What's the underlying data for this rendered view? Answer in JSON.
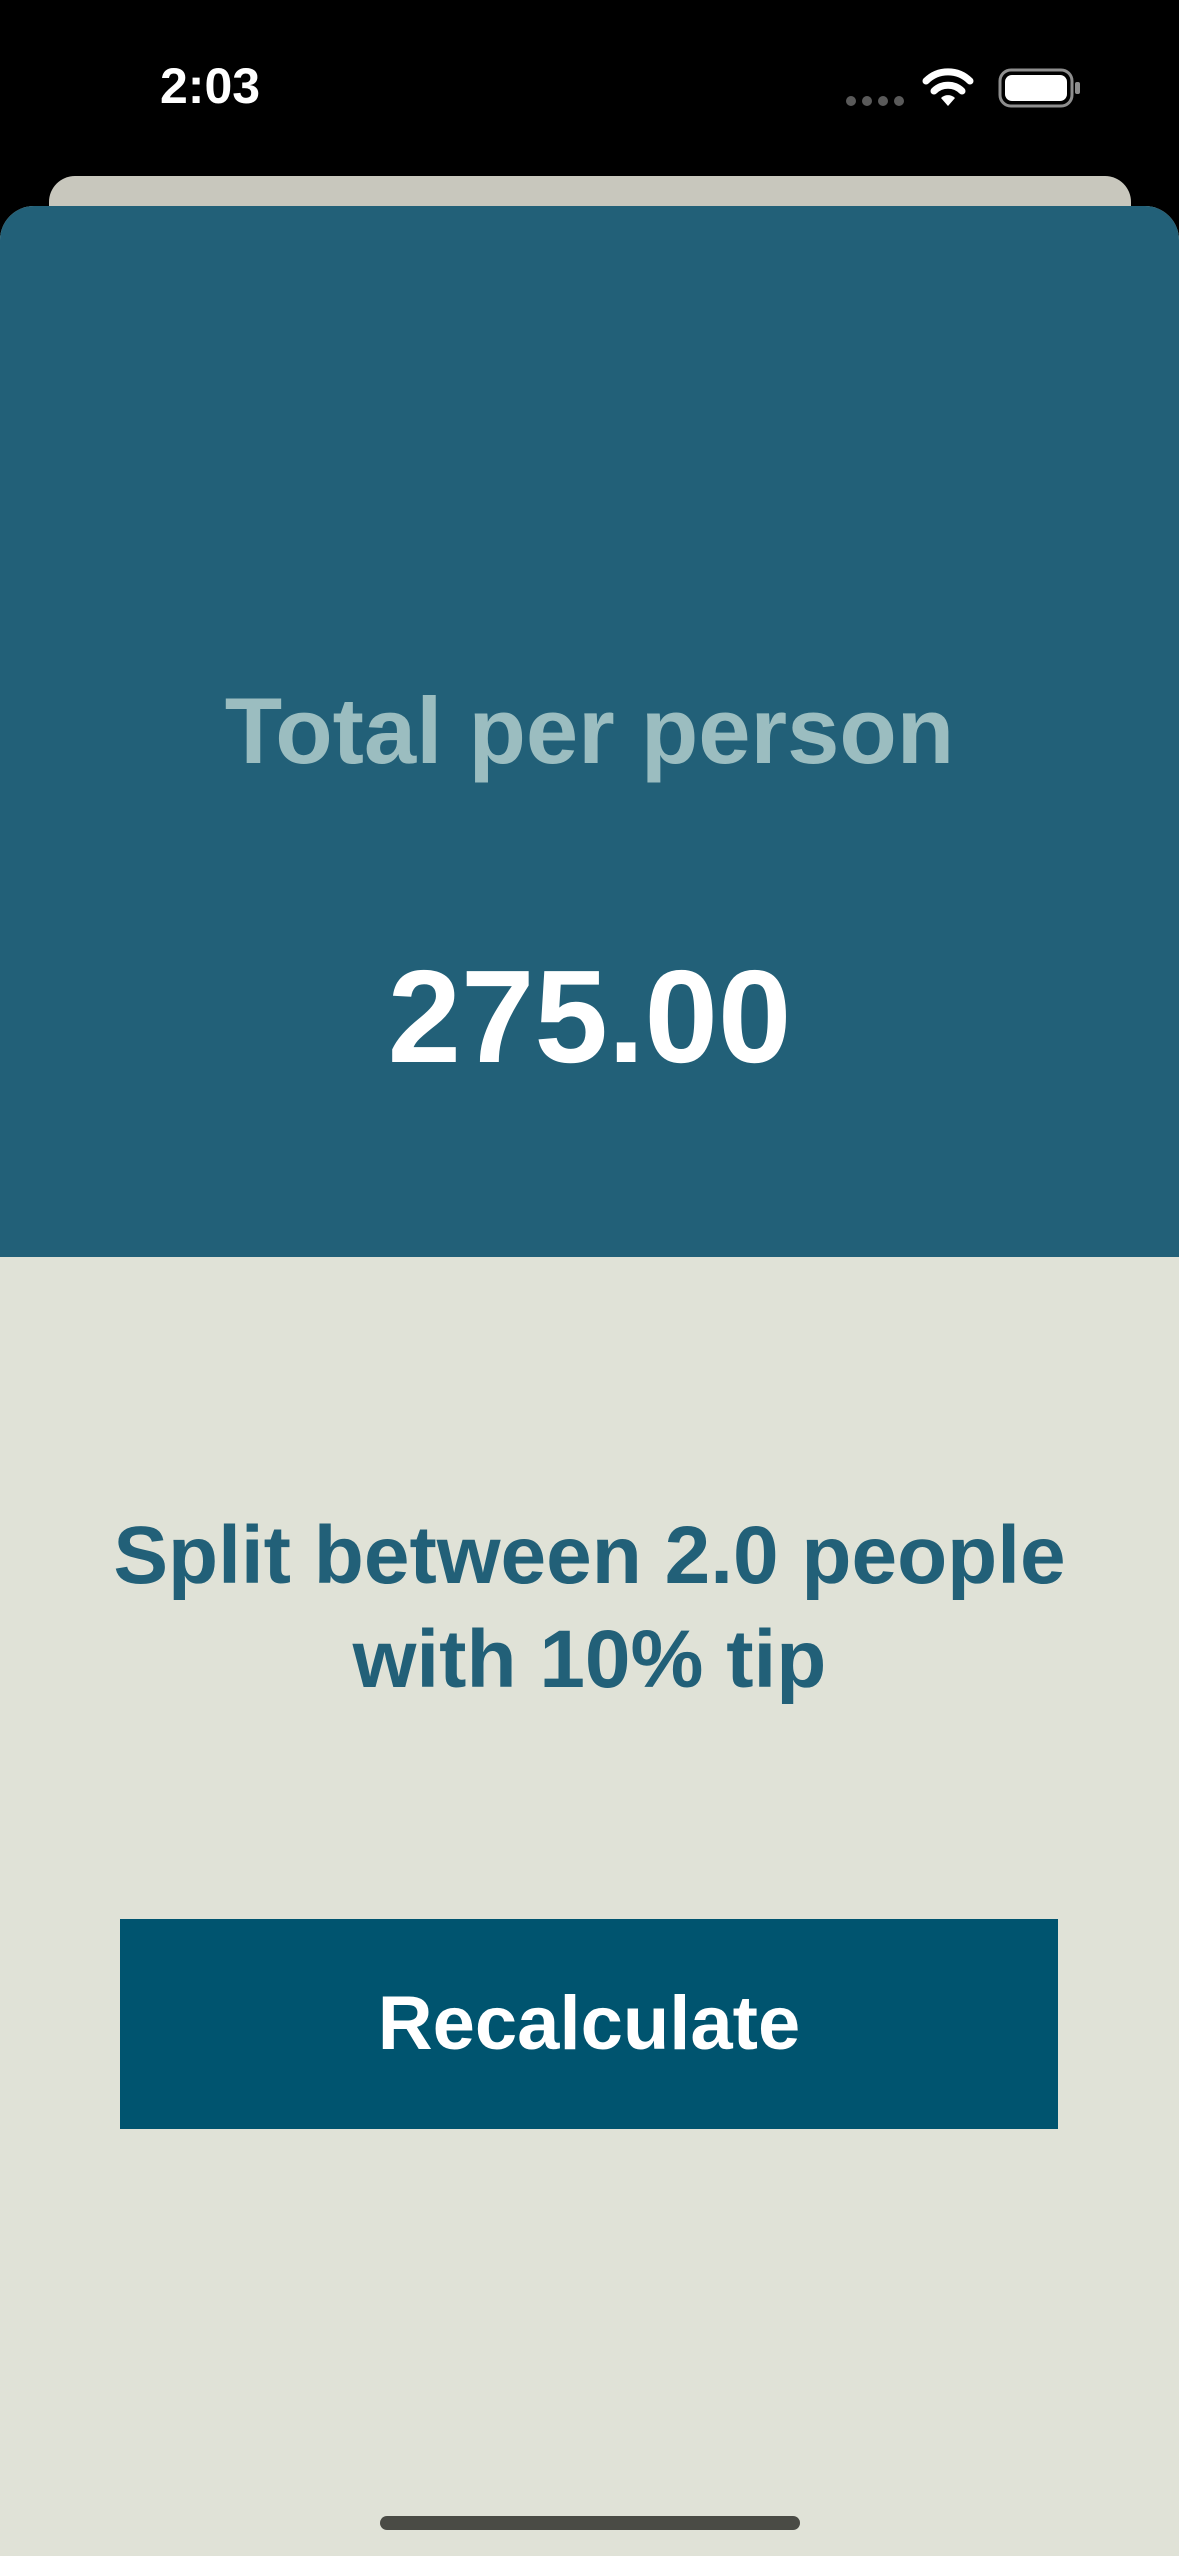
{
  "status_bar": {
    "time": "2:03",
    "icons": [
      "cellular-signal-icon",
      "wifi-icon",
      "battery-icon"
    ]
  },
  "result": {
    "title": "Total per person",
    "value": "275.00"
  },
  "summary": {
    "text": "Split between 2.0 people with 10% tip"
  },
  "actions": {
    "recalculate_label": "Recalculate"
  },
  "colors": {
    "panel_background": "#226078",
    "title_text": "#9bbdc0",
    "page_background": "#e0e2d7",
    "summary_text": "#226078",
    "button_background": "#00546f"
  }
}
